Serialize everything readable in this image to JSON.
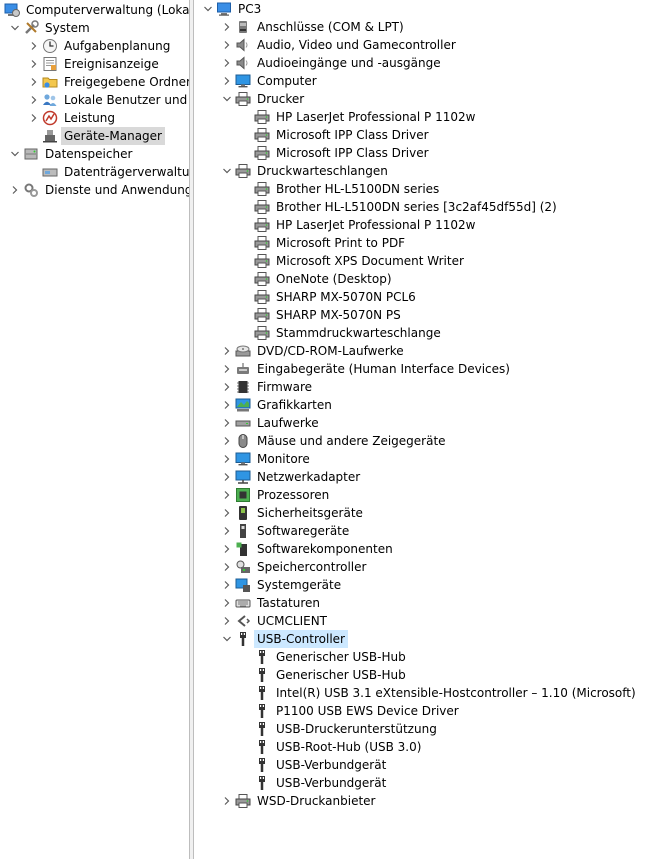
{
  "left_tree": [
    {
      "label": "Computerverwaltung (Lokal)",
      "icon": "computer-management-icon",
      "depth": 0,
      "expand": "none"
    },
    {
      "label": "System",
      "icon": "tools-icon",
      "depth": 1,
      "expand": "open"
    },
    {
      "label": "Aufgabenplanung",
      "icon": "clock-icon",
      "depth": 2,
      "expand": "closed"
    },
    {
      "label": "Ereignisanzeige",
      "icon": "event-viewer-icon",
      "depth": 2,
      "expand": "closed"
    },
    {
      "label": "Freigegebene Ordner",
      "icon": "shared-folder-icon",
      "depth": 2,
      "expand": "closed"
    },
    {
      "label": "Lokale Benutzer und Gruppen",
      "icon": "users-icon",
      "depth": 2,
      "expand": "closed"
    },
    {
      "label": "Leistung",
      "icon": "performance-icon",
      "depth": 2,
      "expand": "closed"
    },
    {
      "label": "Geräte-Manager",
      "icon": "device-manager-icon",
      "depth": 2,
      "expand": "none",
      "selected": true
    },
    {
      "label": "Datenspeicher",
      "icon": "storage-icon",
      "depth": 1,
      "expand": "open"
    },
    {
      "label": "Datenträgerverwaltung",
      "icon": "disk-management-icon",
      "depth": 2,
      "expand": "none"
    },
    {
      "label": "Dienste und Anwendungen",
      "icon": "services-icon",
      "depth": 1,
      "expand": "closed"
    }
  ],
  "right_tree": [
    {
      "label": "PC3",
      "icon": "computer-icon",
      "depth": 0,
      "expand": "open"
    },
    {
      "label": "Anschlüsse (COM & LPT)",
      "icon": "port-icon",
      "depth": 1,
      "expand": "closed"
    },
    {
      "label": "Audio, Video und Gamecontroller",
      "icon": "speaker-icon",
      "depth": 1,
      "expand": "closed"
    },
    {
      "label": "Audioeingänge und -ausgänge",
      "icon": "speaker-icon",
      "depth": 1,
      "expand": "closed"
    },
    {
      "label": "Computer",
      "icon": "monitor-icon",
      "depth": 1,
      "expand": "closed"
    },
    {
      "label": "Drucker",
      "icon": "printer-icon",
      "depth": 1,
      "expand": "open"
    },
    {
      "label": "HP LaserJet Professional P 1102w",
      "icon": "printer-icon",
      "depth": 2,
      "expand": "none"
    },
    {
      "label": "Microsoft IPP Class Driver",
      "icon": "printer-icon",
      "depth": 2,
      "expand": "none"
    },
    {
      "label": "Microsoft IPP Class Driver",
      "icon": "printer-icon",
      "depth": 2,
      "expand": "none"
    },
    {
      "label": "Druckwarteschlangen",
      "icon": "printer-icon",
      "depth": 1,
      "expand": "open"
    },
    {
      "label": "Brother HL-L5100DN series",
      "icon": "printer-icon",
      "depth": 2,
      "expand": "none"
    },
    {
      "label": "Brother HL-L5100DN series [3c2af45df55d] (2)",
      "icon": "printer-icon",
      "depth": 2,
      "expand": "none"
    },
    {
      "label": "HP LaserJet Professional P 1102w",
      "icon": "printer-icon",
      "depth": 2,
      "expand": "none"
    },
    {
      "label": "Microsoft Print to PDF",
      "icon": "printer-icon",
      "depth": 2,
      "expand": "none"
    },
    {
      "label": "Microsoft XPS Document Writer",
      "icon": "printer-icon",
      "depth": 2,
      "expand": "none"
    },
    {
      "label": "OneNote (Desktop)",
      "icon": "printer-icon",
      "depth": 2,
      "expand": "none"
    },
    {
      "label": "SHARP MX-5070N PCL6",
      "icon": "printer-icon",
      "depth": 2,
      "expand": "none"
    },
    {
      "label": "SHARP MX-5070N PS",
      "icon": "printer-icon",
      "depth": 2,
      "expand": "none"
    },
    {
      "label": "Stammdruckwarteschlange",
      "icon": "printer-icon",
      "depth": 2,
      "expand": "none"
    },
    {
      "label": "DVD/CD-ROM-Laufwerke",
      "icon": "dvd-drive-icon",
      "depth": 1,
      "expand": "closed"
    },
    {
      "label": "Eingabegeräte (Human Interface Devices)",
      "icon": "hid-icon",
      "depth": 1,
      "expand": "closed"
    },
    {
      "label": "Firmware",
      "icon": "chip-icon",
      "depth": 1,
      "expand": "closed"
    },
    {
      "label": "Grafikkarten",
      "icon": "display-adapter-icon",
      "depth": 1,
      "expand": "closed"
    },
    {
      "label": "Laufwerke",
      "icon": "disk-drive-icon",
      "depth": 1,
      "expand": "closed"
    },
    {
      "label": "Mäuse und andere Zeigegeräte",
      "icon": "mouse-icon",
      "depth": 1,
      "expand": "closed"
    },
    {
      "label": "Monitore",
      "icon": "monitor-icon",
      "depth": 1,
      "expand": "closed"
    },
    {
      "label": "Netzwerkadapter",
      "icon": "network-adapter-icon",
      "depth": 1,
      "expand": "closed"
    },
    {
      "label": "Prozessoren",
      "icon": "processor-icon",
      "depth": 1,
      "expand": "closed"
    },
    {
      "label": "Sicherheitsgeräte",
      "icon": "security-device-icon",
      "depth": 1,
      "expand": "closed"
    },
    {
      "label": "Softwaregeräte",
      "icon": "software-device-icon",
      "depth": 1,
      "expand": "closed"
    },
    {
      "label": "Softwarekomponenten",
      "icon": "software-component-icon",
      "depth": 1,
      "expand": "closed"
    },
    {
      "label": "Speichercontroller",
      "icon": "storage-controller-icon",
      "depth": 1,
      "expand": "closed"
    },
    {
      "label": "Systemgeräte",
      "icon": "system-device-icon",
      "depth": 1,
      "expand": "closed"
    },
    {
      "label": "Tastaturen",
      "icon": "keyboard-icon",
      "depth": 1,
      "expand": "closed"
    },
    {
      "label": "UCMCLIENT",
      "icon": "ucm-client-icon",
      "depth": 1,
      "expand": "closed"
    },
    {
      "label": "USB-Controller",
      "icon": "usb-icon",
      "depth": 1,
      "expand": "open",
      "selected": true
    },
    {
      "label": "Generischer USB-Hub",
      "icon": "usb-icon",
      "depth": 2,
      "expand": "none"
    },
    {
      "label": "Generischer USB-Hub",
      "icon": "usb-icon",
      "depth": 2,
      "expand": "none"
    },
    {
      "label": "Intel(R) USB 3.1 eXtensible-Hostcontroller – 1.10 (Microsoft)",
      "icon": "usb-icon",
      "depth": 2,
      "expand": "none"
    },
    {
      "label": "P1100 USB EWS Device Driver",
      "icon": "usb-icon",
      "depth": 2,
      "expand": "none"
    },
    {
      "label": "USB-Druckerunterstützung",
      "icon": "usb-icon",
      "depth": 2,
      "expand": "none"
    },
    {
      "label": "USB-Root-Hub (USB 3.0)",
      "icon": "usb-icon",
      "depth": 2,
      "expand": "none"
    },
    {
      "label": "USB-Verbundgerät",
      "icon": "usb-icon",
      "depth": 2,
      "expand": "none"
    },
    {
      "label": "USB-Verbundgerät",
      "icon": "usb-icon",
      "depth": 2,
      "expand": "none"
    },
    {
      "label": "WSD-Druckanbieter",
      "icon": "printer-icon",
      "depth": 1,
      "expand": "closed"
    }
  ],
  "colors": {
    "selected_inactive": "#d9d9d9",
    "selected_active": "#cce8ff",
    "chevron": "#5a5a5a",
    "splitter": "#f0f0f0"
  }
}
